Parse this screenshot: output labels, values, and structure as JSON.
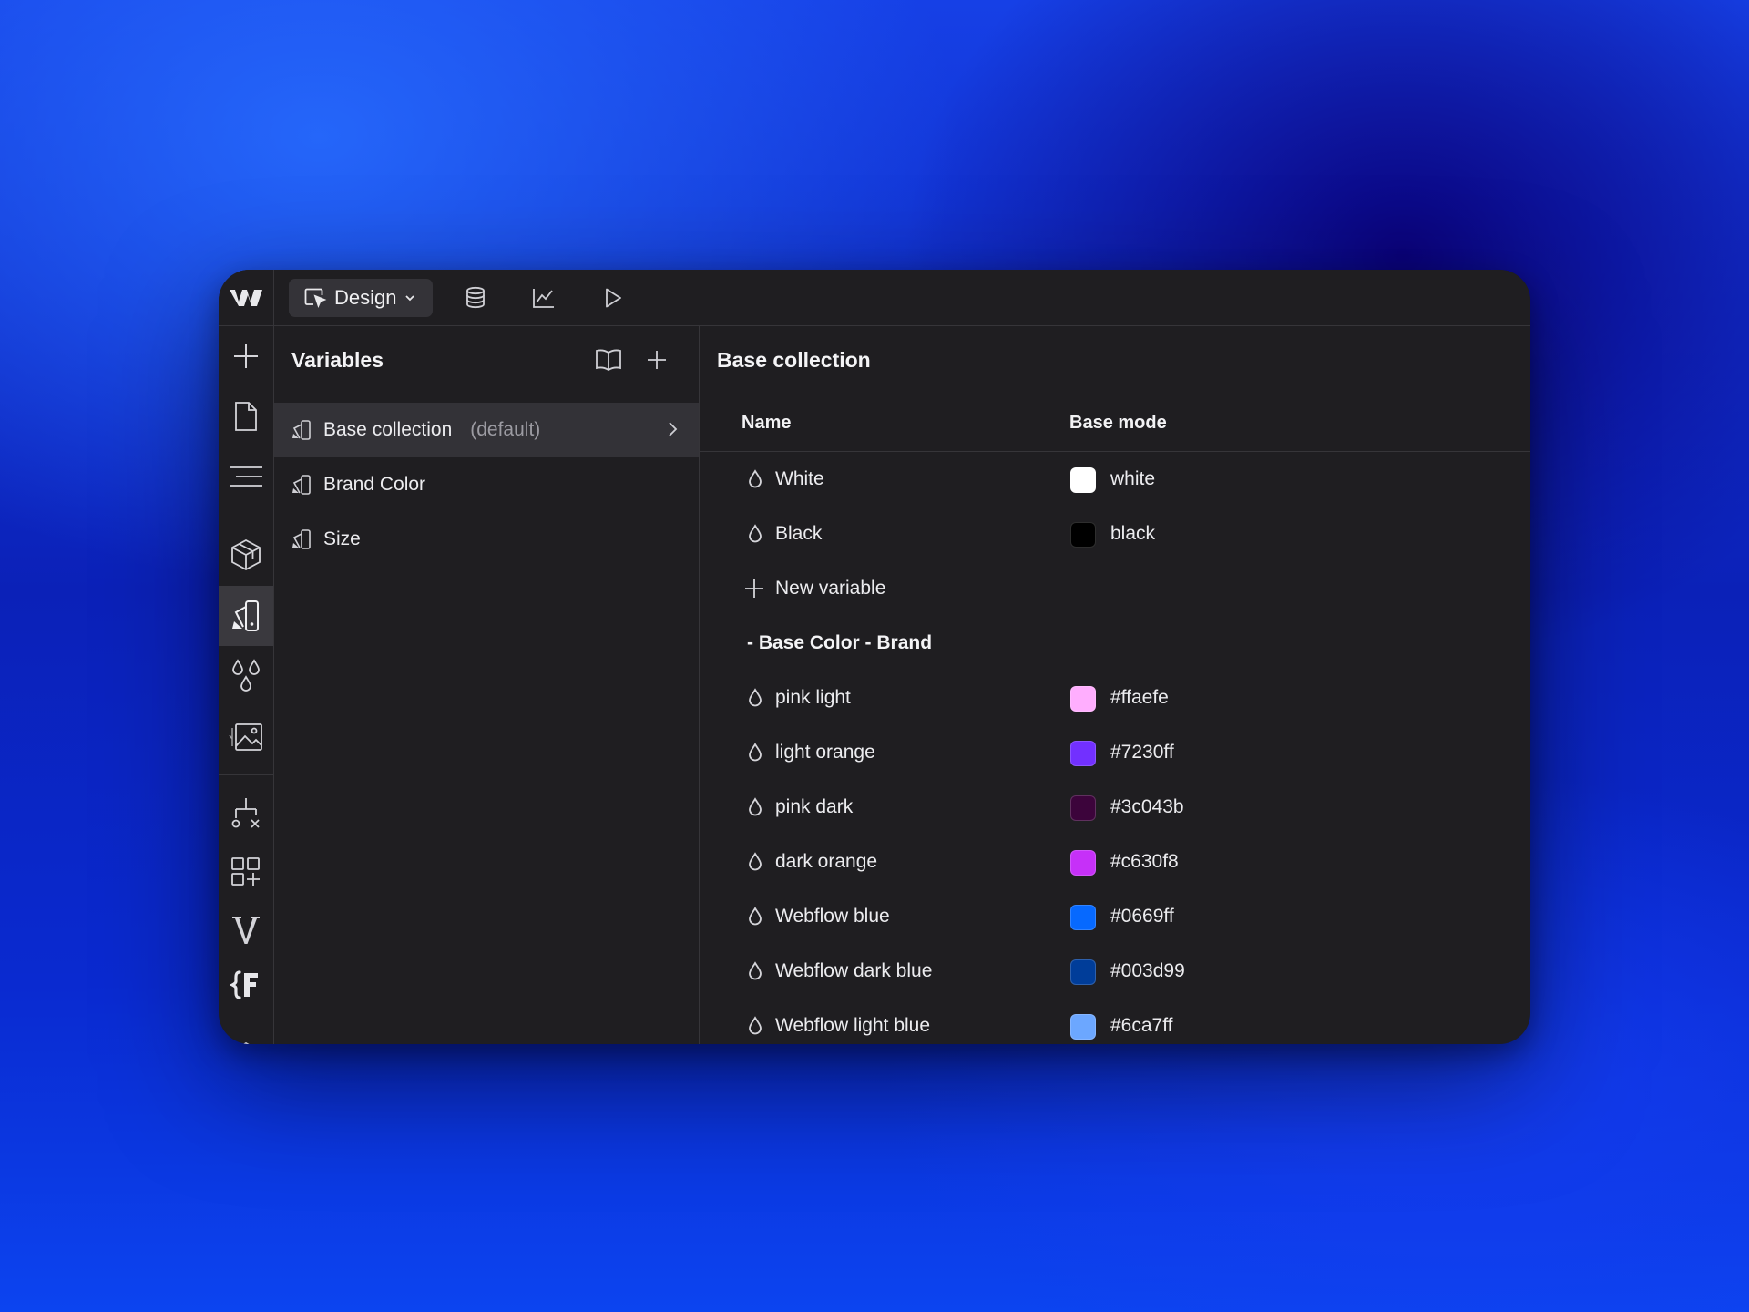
{
  "topbar": {
    "mode_label": "Design",
    "icons": [
      "webflow-logo-icon",
      "cursor-select-icon",
      "chevron-down-icon",
      "database-icon",
      "chart-icon",
      "play-icon"
    ]
  },
  "rail": {
    "icons": [
      "plus-icon",
      "page-icon",
      "navigator-icon",
      "cube-icon",
      "variables-icon",
      "swatches-icon",
      "assets-icon",
      "logic-icon",
      "apps-icon",
      "v-icon",
      "brackets-f-icon"
    ],
    "active": "variables-icon"
  },
  "variables_panel": {
    "title": "Variables",
    "collections": [
      {
        "label": "Base collection",
        "suffix": "(default)"
      },
      {
        "label": "Brand Color",
        "suffix": ""
      },
      {
        "label": "Size",
        "suffix": ""
      }
    ]
  },
  "table": {
    "title": "Base collection",
    "col_name": "Name",
    "col_mode": "Base mode",
    "rows_top": [
      {
        "name": "White",
        "value": "white",
        "color": "#ffffff"
      },
      {
        "name": "Black",
        "value": "black",
        "color": "#000000"
      }
    ],
    "new_variable_label": "New variable",
    "group_label": "- Base Color - Brand",
    "rows_group": [
      {
        "name": "pink light",
        "value": "#ffaefe",
        "color": "#ffaefe"
      },
      {
        "name": "light orange",
        "value": "#7230ff",
        "color": "#7230ff"
      },
      {
        "name": "pink dark",
        "value": "#3c043b",
        "color": "#3c043b"
      },
      {
        "name": "dark orange",
        "value": "#c630f8",
        "color": "#c630f8"
      },
      {
        "name": "Webflow blue",
        "value": "#0669ff",
        "color": "#0669ff"
      },
      {
        "name": "Webflow dark blue",
        "value": "#003d99",
        "color": "#003d99"
      },
      {
        "name": "Webflow light blue",
        "value": "#6ca7ff",
        "color": "#6ca7ff"
      }
    ]
  }
}
